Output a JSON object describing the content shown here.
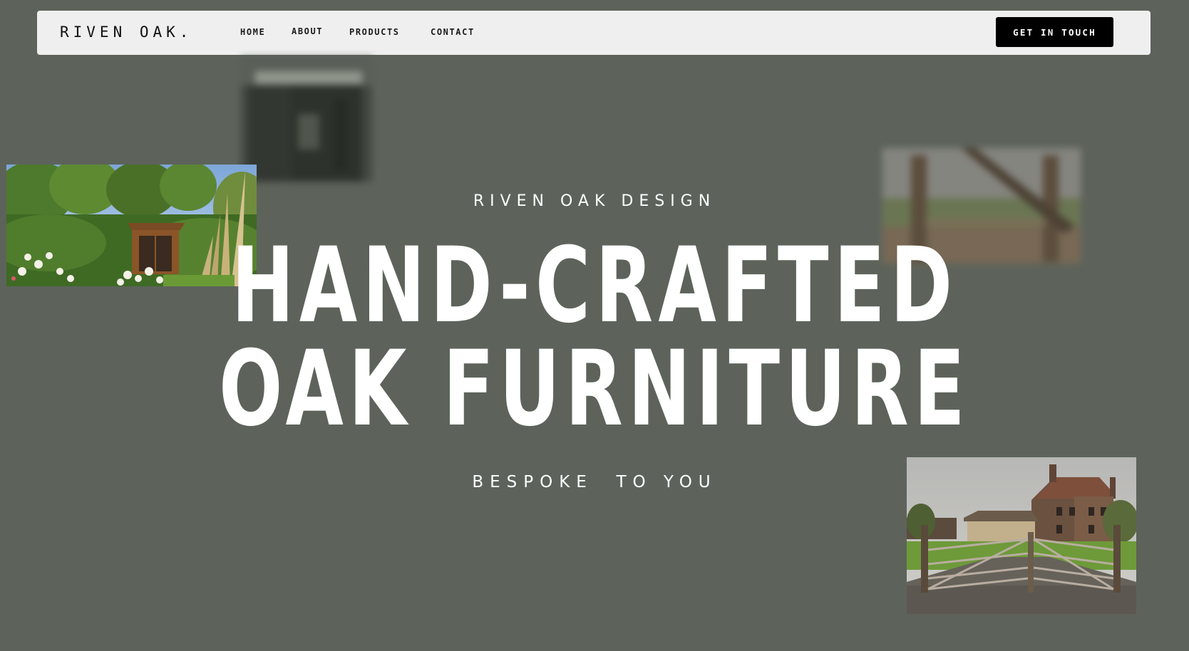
{
  "nav": {
    "logo": "RIVEN OAK.",
    "links": {
      "home": "HOME",
      "about": "ABOUT",
      "products": "PRODUCTS",
      "contact": "CONTACT"
    },
    "cta_label": "GET IN TOUCH"
  },
  "hero": {
    "eyebrow": "RIVEN OAK DESIGN",
    "headline_line1": "HAND-CRAFTED",
    "headline_line2": "OAK FURNITURE",
    "tagline": "BESPOKE  TO YOU"
  },
  "colors": {
    "background": "#5d635b",
    "nav_background": "#efefef",
    "cta_background": "#000000",
    "hero_text": "#ffffff"
  },
  "icons": {
    "photos": [
      "garden-summerhouse-photo",
      "blurred-barn-photo",
      "blurred-gate-photo",
      "farmhouse-gate-photo"
    ]
  }
}
